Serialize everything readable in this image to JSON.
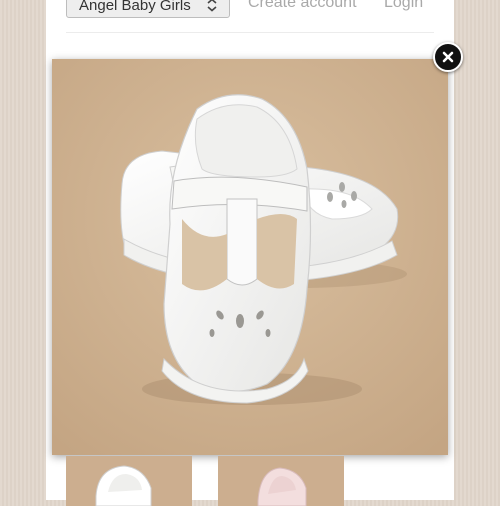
{
  "header": {
    "category_select": {
      "value": "Angel Baby Girls"
    },
    "create_account_label": "Create account",
    "login_label": "Login"
  },
  "lightbox": {
    "image_subject": "white leather baby T-strap shoes with scalloped trim and teardrop cutouts",
    "close_icon": "close-icon"
  },
  "thumbnails": [
    {
      "subject": "white baby shoe thumbnail"
    },
    {
      "subject": "pink baby shoe thumbnail"
    }
  ],
  "colors": {
    "backdrop": "#e0d6cc",
    "photo_background": "#ceb191",
    "link_text": "#a9a9a9",
    "close_button": "#111111"
  }
}
